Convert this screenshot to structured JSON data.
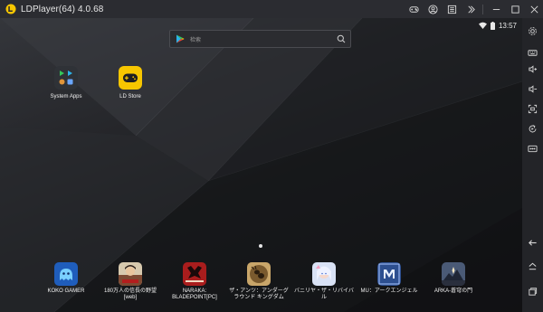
{
  "window": {
    "title": "LDPlayer(64) 4.0.68"
  },
  "title_controls": [
    {
      "name": "gamepad-icon"
    },
    {
      "name": "account-icon"
    },
    {
      "name": "menu-icon"
    },
    {
      "name": "expand-icon"
    },
    {
      "name": "minimize-icon"
    },
    {
      "name": "maximize-icon"
    },
    {
      "name": "close-icon"
    }
  ],
  "statusbar": {
    "time": "13:57"
  },
  "search": {
    "placeholder": "检索"
  },
  "home_apps": [
    {
      "label": "System Apps",
      "icon": "system-apps-folder-icon"
    },
    {
      "label": "LD Store",
      "icon": "ld-store-icon"
    }
  ],
  "dock_apps": [
    {
      "label": "KOKO GAMER",
      "icon": "koko-gamer-icon",
      "color": "#1f5dbb"
    },
    {
      "label": "180万人の信長の野望\n[web]",
      "icon": "nobunaga-icon",
      "color": "#7d4a33"
    },
    {
      "label": "NARAKA:\nBLADEPOINT[PC]",
      "icon": "naraka-icon",
      "color": "#a91d1d"
    },
    {
      "label": "ザ・アンツ：アンダーグ\nラウンド キングダム",
      "icon": "the-ants-icon",
      "color": "#7a5a2e"
    },
    {
      "label": "バニリヤ・ザ・リバイバ\nル",
      "icon": "vanilla-revival-icon",
      "color": "#b9c8e8"
    },
    {
      "label": "MU：アークエンジェル",
      "icon": "mu-archangel-icon",
      "color": "#2d4f8f"
    },
    {
      "label": "ARKA-蒼穹の門",
      "icon": "arka-icon",
      "color": "#4a5a76"
    }
  ],
  "sidebar_tools": [
    {
      "name": "settings-icon"
    },
    {
      "name": "keyboard-icon"
    },
    {
      "name": "volume-up-icon"
    },
    {
      "name": "volume-down-icon"
    },
    {
      "name": "fullscreen-icon"
    },
    {
      "name": "rotate-icon"
    },
    {
      "name": "more-icon"
    },
    {
      "name": "back-icon"
    },
    {
      "name": "home-icon"
    },
    {
      "name": "recent-apps-icon"
    }
  ],
  "colors": {
    "accent_yellow": "#f7c600",
    "titlebar": "#2b2c31",
    "sidebar": "#232428"
  }
}
